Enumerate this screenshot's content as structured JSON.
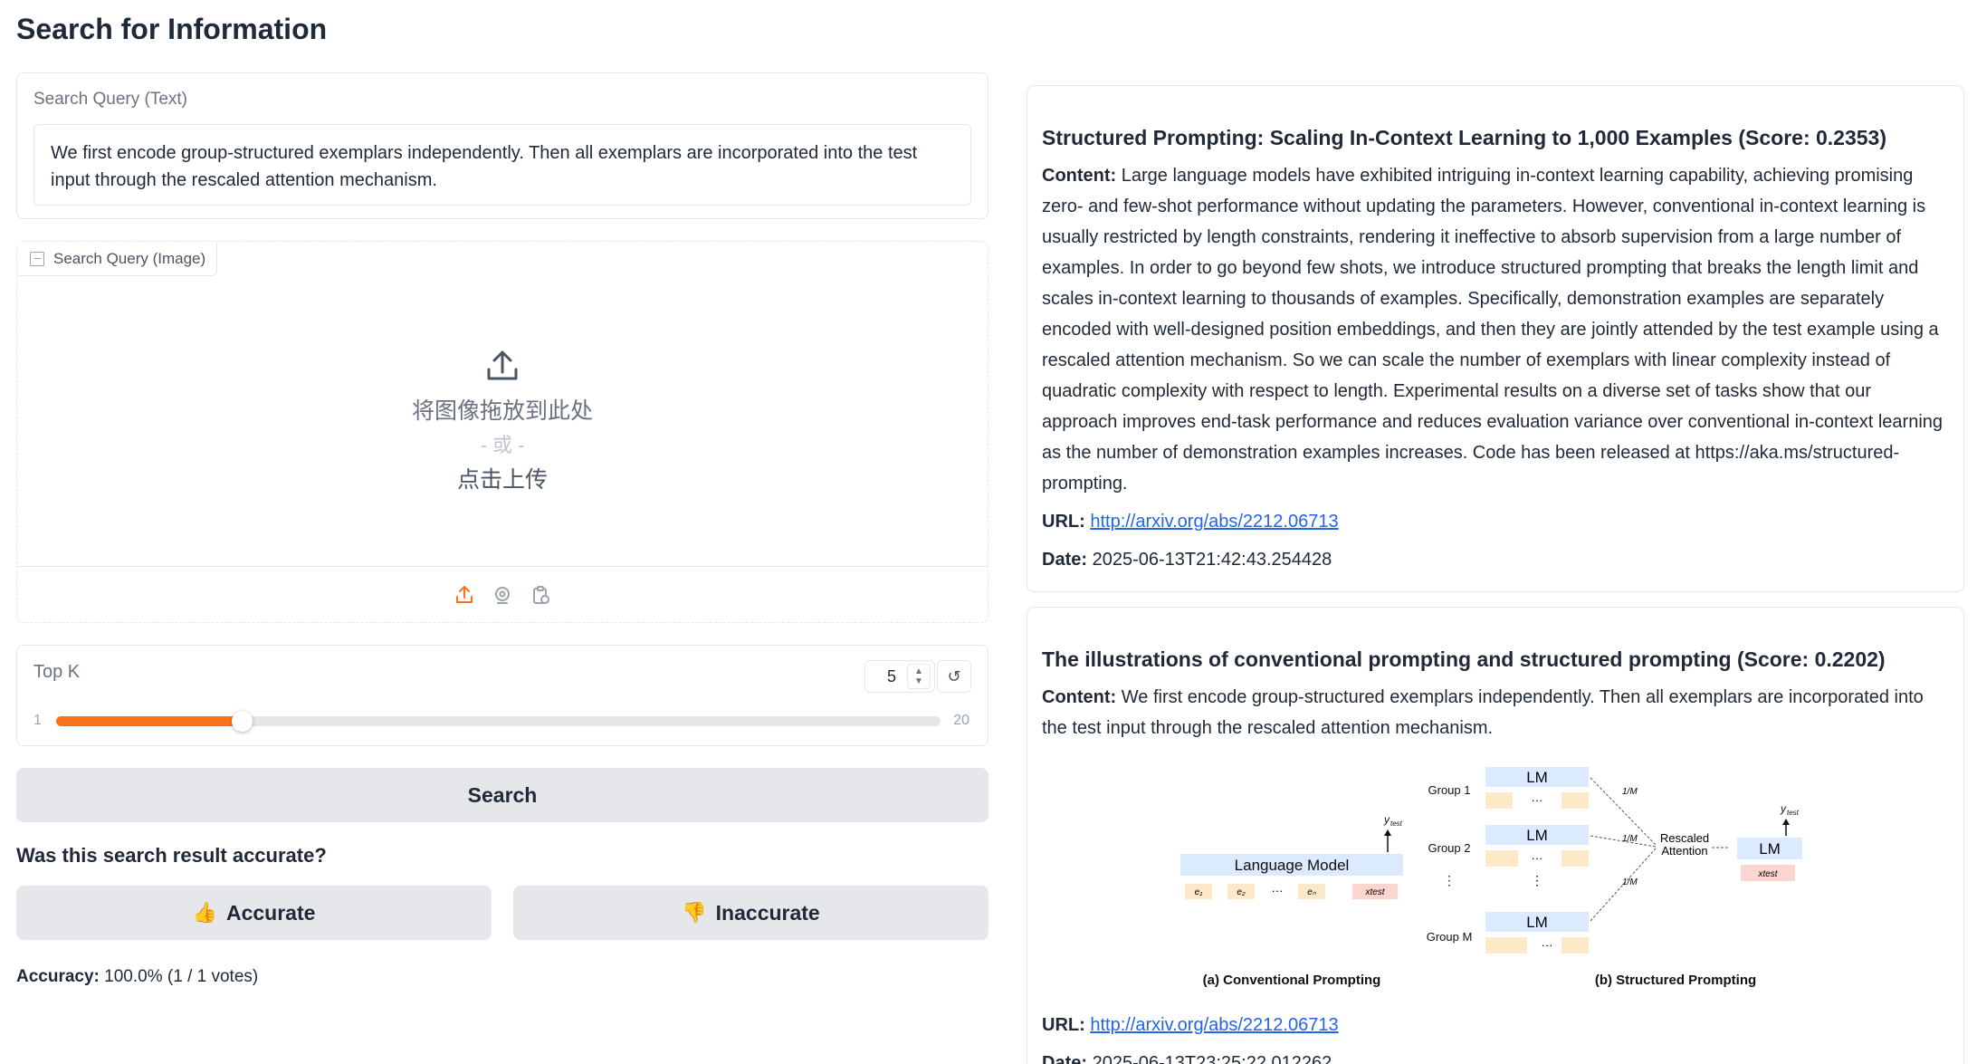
{
  "page": {
    "title": "Search for Information"
  },
  "text_query": {
    "label": "Search Query (Text)",
    "value": "We first encode group-structured exemplars independently. Then all exemplars are incorporated into the test input through the rescaled attention mechanism."
  },
  "image_query": {
    "label": "Search Query (Image)",
    "drop_text": "将图像拖放到此处",
    "or_text": "- 或 -",
    "click_text": "点击上传",
    "toolbar_icons": [
      "upload-icon",
      "webcam-icon",
      "clipboard-icon"
    ]
  },
  "top_k": {
    "label": "Top K",
    "value": "5",
    "min": "1",
    "max": "20",
    "fraction": 0.2105,
    "reset_glyph": "↺"
  },
  "search_button": {
    "label": "Search"
  },
  "feedback": {
    "question": "Was this search result accurate?",
    "accurate_label": "Accurate",
    "inaccurate_label": "Inaccurate",
    "accuracy_label": "Accuracy:",
    "accuracy_value": "100.0% (1 / 1 votes)"
  },
  "colors": {
    "accent": "#f97316",
    "link": "#2563eb",
    "button_bg": "#e5e7eb"
  },
  "results": [
    {
      "title": "Structured Prompting: Scaling In-Context Learning to 1,000 Examples (Score: 0.2353)",
      "content_label": "Content:",
      "content": "Large language models have exhibited intriguing in-context learning capability, achieving promising zero- and few-shot performance without updating the parameters. However, conventional in-context learning is usually restricted by length constraints, rendering it ineffective to absorb supervision from a large number of examples. In order to go beyond few shots, we introduce structured prompting that breaks the length limit and scales in-context learning to thousands of examples. Specifically, demonstration examples are separately encoded with well-designed position embeddings, and then they are jointly attended by the test example using a rescaled attention mechanism. So we can scale the number of exemplars with linear complexity instead of quadratic complexity with respect to length. Experimental results on a diverse set of tasks show that our approach improves end-task performance and reduces evaluation variance over conventional in-context learning as the number of demonstration examples increases. Code has been released at https://aka.ms/structured-prompting.",
      "url_label": "URL:",
      "url": "http://arxiv.org/abs/2212.06713",
      "date_label": "Date:",
      "date": "2025-06-13T21:42:43.254428"
    },
    {
      "title": "The illustrations of conventional prompting and structured prompting (Score: 0.2202)",
      "content_label": "Content:",
      "content": "We first encode group-structured exemplars independently. Then all exemplars are incorporated into the test input through the rescaled attention mechanism.",
      "url_label": "URL:",
      "url": "http://arxiv.org/abs/2212.06713",
      "date_label": "Date:",
      "date": "2025-06-13T23:25:22.012262",
      "figure": {
        "caption_a": "(a) Conventional Prompting",
        "caption_b": "(b) Structured Prompting",
        "language_model": "Language Model",
        "lm": "LM",
        "group_1": "Group 1",
        "group_2": "Group 2",
        "group_m": "Group M",
        "rescaled_1": "Rescaled",
        "rescaled_2": "Attention",
        "frac": "1/M"
      }
    }
  ]
}
